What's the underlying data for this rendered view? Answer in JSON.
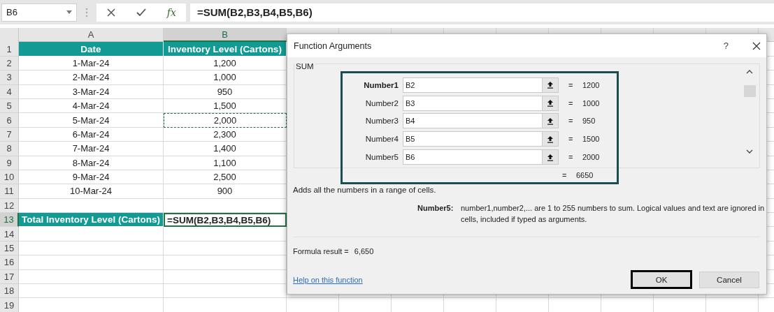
{
  "name_box": "B6",
  "formula_bar": {
    "function_label": "fx",
    "formula": "=SUM(B2,B3,B4,B5,B6)"
  },
  "columns": [
    {
      "label": "A",
      "selected": false
    },
    {
      "label": "B",
      "selected": true
    }
  ],
  "rows": [
    {
      "number": "1",
      "selected": false,
      "cells": [
        {
          "text": "Date",
          "kind": "header",
          "marquee": false,
          "active": false
        },
        {
          "text": "Inventory Level (Cartons)",
          "kind": "header",
          "marquee": false,
          "active": false
        }
      ]
    },
    {
      "number": "2",
      "selected": false,
      "cells": [
        {
          "text": "1-Mar-24",
          "kind": "plain",
          "marquee": false,
          "active": false
        },
        {
          "text": "1,200",
          "kind": "plain",
          "marquee": false,
          "active": false
        }
      ]
    },
    {
      "number": "3",
      "selected": false,
      "cells": [
        {
          "text": "2-Mar-24",
          "kind": "plain",
          "marquee": false,
          "active": false
        },
        {
          "text": "1,000",
          "kind": "plain",
          "marquee": false,
          "active": false
        }
      ]
    },
    {
      "number": "4",
      "selected": false,
      "cells": [
        {
          "text": "3-Mar-24",
          "kind": "plain",
          "marquee": false,
          "active": false
        },
        {
          "text": "950",
          "kind": "plain",
          "marquee": false,
          "active": false
        }
      ]
    },
    {
      "number": "5",
      "selected": false,
      "cells": [
        {
          "text": "4-Mar-24",
          "kind": "plain",
          "marquee": false,
          "active": false
        },
        {
          "text": "1,500",
          "kind": "plain",
          "marquee": false,
          "active": false
        }
      ]
    },
    {
      "number": "6",
      "selected": false,
      "cells": [
        {
          "text": "5-Mar-24",
          "kind": "plain",
          "marquee": false,
          "active": false
        },
        {
          "text": "2,000",
          "kind": "plain",
          "marquee": true,
          "active": false
        }
      ]
    },
    {
      "number": "7",
      "selected": false,
      "cells": [
        {
          "text": "6-Mar-24",
          "kind": "plain",
          "marquee": false,
          "active": false
        },
        {
          "text": "2,300",
          "kind": "plain",
          "marquee": false,
          "active": false
        }
      ]
    },
    {
      "number": "8",
      "selected": false,
      "cells": [
        {
          "text": "7-Mar-24",
          "kind": "plain",
          "marquee": false,
          "active": false
        },
        {
          "text": "1,400",
          "kind": "plain",
          "marquee": false,
          "active": false
        }
      ]
    },
    {
      "number": "9",
      "selected": false,
      "cells": [
        {
          "text": "8-Mar-24",
          "kind": "plain",
          "marquee": false,
          "active": false
        },
        {
          "text": "1,100",
          "kind": "plain",
          "marquee": false,
          "active": false
        }
      ]
    },
    {
      "number": "10",
      "selected": false,
      "cells": [
        {
          "text": "9-Mar-24",
          "kind": "plain",
          "marquee": false,
          "active": false
        },
        {
          "text": "2,500",
          "kind": "plain",
          "marquee": false,
          "active": false
        }
      ]
    },
    {
      "number": "11",
      "selected": false,
      "cells": [
        {
          "text": "10-Mar-24",
          "kind": "plain",
          "marquee": false,
          "active": false
        },
        {
          "text": "900",
          "kind": "plain",
          "marquee": false,
          "active": false
        }
      ]
    },
    {
      "number": "12",
      "selected": false,
      "cells": []
    },
    {
      "number": "13",
      "selected": true,
      "cells": [
        {
          "text": "Total Inventory Level (Cartons)",
          "kind": "total",
          "marquee": false,
          "active": false
        },
        {
          "text": "=SUM(B2,B3,B4,B5,B6)",
          "kind": "formula",
          "marquee": false,
          "active": true
        }
      ]
    },
    {
      "number": "14",
      "selected": false,
      "cells": []
    },
    {
      "number": "15",
      "selected": false,
      "cells": []
    },
    {
      "number": "16",
      "selected": false,
      "cells": []
    },
    {
      "number": "17",
      "selected": false,
      "cells": []
    },
    {
      "number": "18",
      "selected": false,
      "cells": []
    },
    {
      "number": "19",
      "selected": false,
      "cells": []
    }
  ],
  "dialog": {
    "title": "Function Arguments",
    "help": "?",
    "function_name": "SUM",
    "arguments": [
      {
        "label": "Number1",
        "value": "B2",
        "equals": "=",
        "result": "1200",
        "required": true
      },
      {
        "label": "Number2",
        "value": "B3",
        "equals": "=",
        "result": "1000",
        "required": false
      },
      {
        "label": "Number3",
        "value": "B4",
        "equals": "=",
        "result": "950",
        "required": false
      },
      {
        "label": "Number4",
        "value": "B5",
        "equals": "=",
        "result": "1500",
        "required": false
      },
      {
        "label": "Number5",
        "value": "B6",
        "equals": "=",
        "result": "2000",
        "required": false
      }
    ],
    "total": {
      "equals": "=",
      "value": "6650"
    },
    "description": "Adds all the numbers in a range of cells.",
    "argument_help": {
      "label": "Number5:",
      "text": "number1,number2,... are 1 to 255 numbers to sum. Logical values and text are ignored in cells, included if typed as arguments."
    },
    "formula_result": {
      "label": "Formula result =",
      "value": "6,650"
    },
    "help_link": "Help on this function",
    "buttons": [
      {
        "label": "OK",
        "default": true
      },
      {
        "label": "Cancel",
        "default": false
      }
    ]
  }
}
